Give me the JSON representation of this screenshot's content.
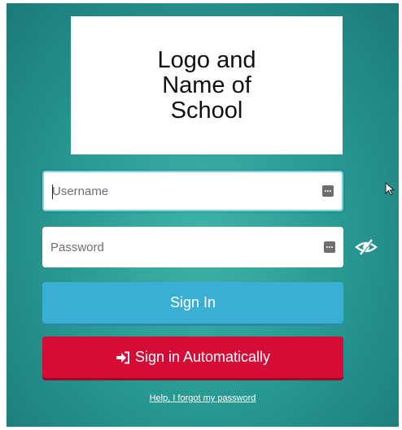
{
  "logo": {
    "text": "Logo and Name of School"
  },
  "username": {
    "placeholder": "Username",
    "value": ""
  },
  "password": {
    "placeholder": "Password",
    "value": ""
  },
  "buttons": {
    "sign_in_label": "Sign In",
    "sign_in_auto_label": "Sign in Automatically"
  },
  "help_link": "Help, I forgot my password",
  "icons": {
    "key_field": "password-manager-icon",
    "eye": "eye-slash-icon",
    "sign_in_auto": "sign-in-arrow-icon",
    "cursor": "mouse-pointer-icon"
  },
  "colors": {
    "background": "#2a9c95",
    "sign_in_button": "#3aaed3",
    "sign_in_auto_button": "#d40c36",
    "focus_border": "#7fd0e6"
  }
}
